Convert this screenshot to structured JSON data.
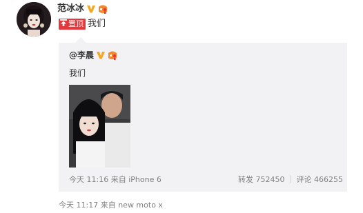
{
  "post": {
    "author": "范冰冰",
    "pin_label": "置顶",
    "text": "我们",
    "time": "今天 11:17",
    "from_prefix": "来自",
    "source": "new moto x"
  },
  "repost": {
    "author_mention": "@李晨",
    "text": "我们",
    "time": "今天 11:16",
    "from_prefix": "来自",
    "source": "iPhone 6",
    "repost_label": "转发",
    "repost_count": "752450",
    "comment_label": "评论",
    "comment_count": "466255"
  },
  "icons": {
    "verified": "verified-v-icon",
    "level": "level-badge-icon",
    "pin": "pin-icon"
  },
  "colors": {
    "pin_badge": "#e4393c",
    "verified": "#f5a623",
    "meta_text": "#808080",
    "repost_bg": "#f2f2f5"
  }
}
